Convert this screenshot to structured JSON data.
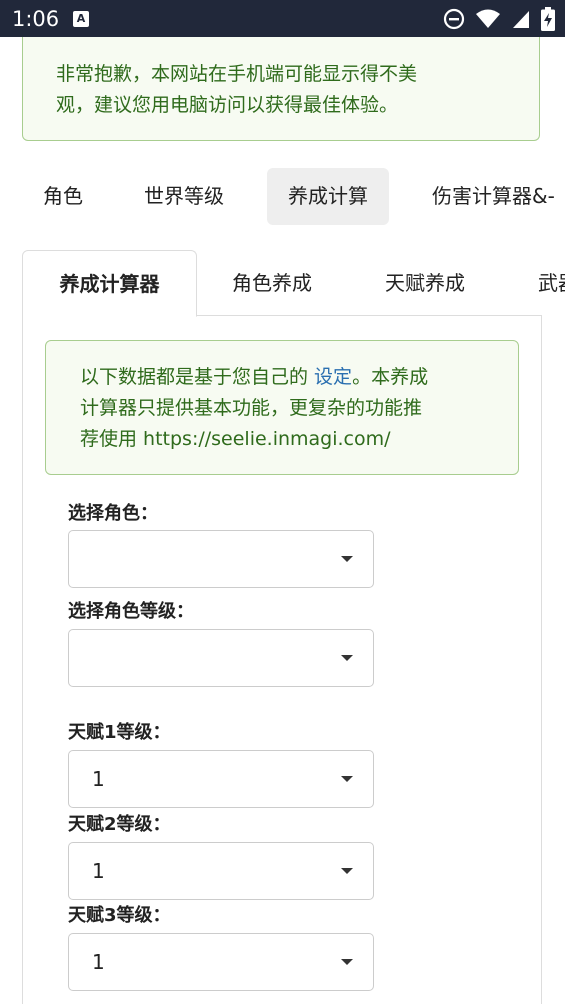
{
  "status_bar": {
    "time": "1:06",
    "notification_icon_letter": "A",
    "icons": [
      "a-notification-icon",
      "do-not-disturb-icon",
      "wifi-icon",
      "battery-charging-icon"
    ]
  },
  "mobile_warning": {
    "line1": "非常抱歉，本网站在手机端可能显示得不美",
    "line2": "观，建议您用电脑访问以获得最佳体验。"
  },
  "top_tabs": [
    {
      "label": "角色",
      "active": false
    },
    {
      "label": "世界等级",
      "active": false
    },
    {
      "label": "养成计算",
      "active": true
    },
    {
      "label": "伤害计算器&-",
      "active": false
    }
  ],
  "inner_tabs": [
    {
      "label": "养成计算器",
      "active": true
    },
    {
      "label": "角色养成",
      "active": false
    },
    {
      "label": "天赋养成",
      "active": false
    },
    {
      "label": "武器",
      "active": false
    }
  ],
  "info_alert": {
    "line1_prefix": "以下数据都是基于您自己的 ",
    "link_text": "设定",
    "line1_suffix": "。本养成",
    "line2": "计算器只提供基本功能，更复杂的功能推",
    "line3": "荐使用 https://seelie.inmagi.com/"
  },
  "form": {
    "character_label": "选择角色：",
    "character_value": "",
    "level_label": "选择角色等级：",
    "level_value": "",
    "talent1_label": "天赋1等级：",
    "talent1_value": "1",
    "talent2_label": "天赋2等级：",
    "talent2_value": "1",
    "talent3_label": "天赋3等级：",
    "talent3_value": "1"
  },
  "colors": {
    "status_bar_bg": "#21283a",
    "alert_bg": "#f7fbf2",
    "alert_border": "#a8cd8f",
    "alert_text": "#2f6b1c",
    "link": "#2a6fb0",
    "active_tab_bg": "#eeeeee"
  }
}
